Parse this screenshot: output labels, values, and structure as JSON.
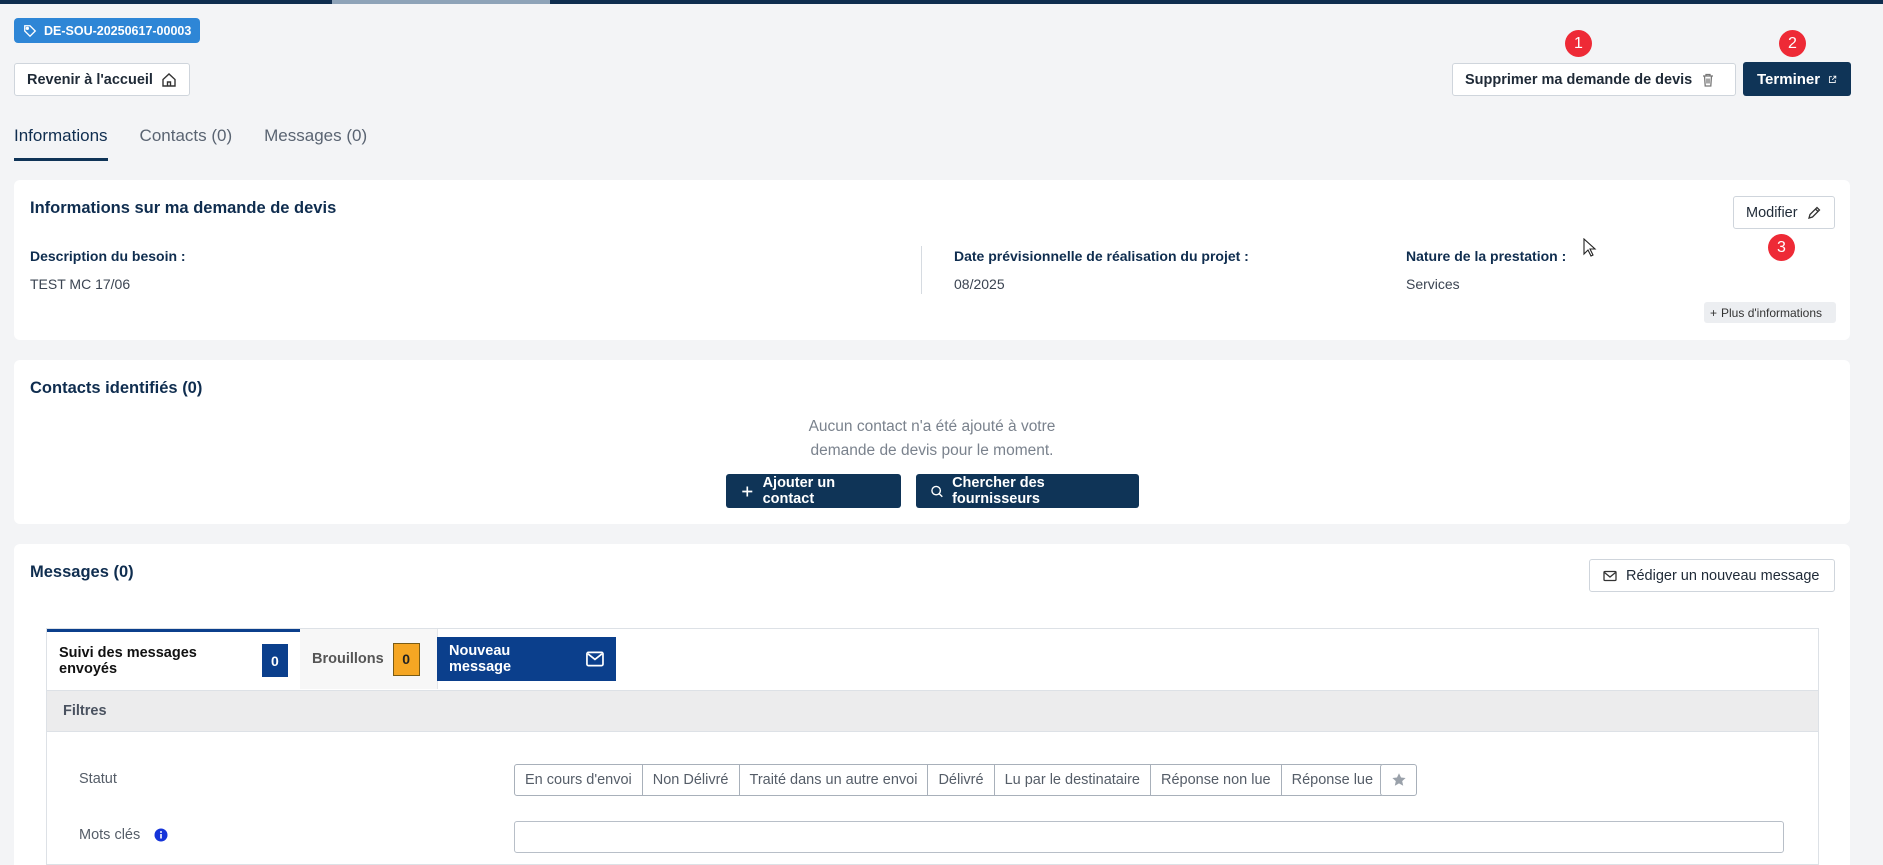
{
  "reference": "DE-SOU-20250617-00003",
  "header": {
    "back_label": "Revenir à l'accueil",
    "delete_label": "Supprimer ma demande de devis",
    "finish_label": "Terminer"
  },
  "annotations": [
    "1",
    "2",
    "3"
  ],
  "tabs": [
    "Informations",
    "Contacts (0)",
    "Messages (0)"
  ],
  "info_card": {
    "title": "Informations sur ma demande de devis",
    "edit_label": "Modifier",
    "fields": [
      {
        "label": "Description du besoin :",
        "value": "TEST MC 17/06"
      },
      {
        "label": "Date prévisionnelle de réalisation du projet :",
        "value": "08/2025"
      },
      {
        "label": "Nature de la prestation :",
        "value": "Services"
      }
    ],
    "more_label": "Plus d'informations"
  },
  "contacts_card": {
    "title": "Contacts identifiés (0)",
    "empty_line1": "Aucun contact n'a été ajouté à votre",
    "empty_line2": "demande de devis pour le moment.",
    "add_label": "Ajouter un contact",
    "search_label": "Chercher des fournisseurs"
  },
  "messages_card": {
    "title": "Messages (0)",
    "new_label": "Rédiger un nouveau message",
    "tabs": {
      "sent_label": "Suivi des messages envoyés",
      "sent_count": "0",
      "drafts_label": "Brouillons",
      "drafts_count": "0",
      "new_message_label": "Nouveau message"
    },
    "filters_label": "Filtres",
    "status_label": "Statut",
    "statuses": [
      "En cours d'envoi",
      "Non Délivré",
      "Traité dans un autre envoi",
      "Délivré",
      "Lu par le destinataire",
      "Réponse non lue",
      "Réponse lue"
    ],
    "keywords_label": "Mots clés"
  },
  "colors": {
    "primary_dark": "#0f3457",
    "tag_blue": "#2e86d6",
    "annotation_red": "#ee2a36",
    "draft_orange": "#f5a623",
    "sent_blue": "#0b3f8c"
  },
  "icons": [
    "tag-icon",
    "home-icon",
    "trash-icon",
    "external-link-icon",
    "pencil-icon",
    "plus-icon",
    "search-icon",
    "mail-icon",
    "envelope-icon",
    "star-icon",
    "info-icon",
    "cursor-icon"
  ]
}
